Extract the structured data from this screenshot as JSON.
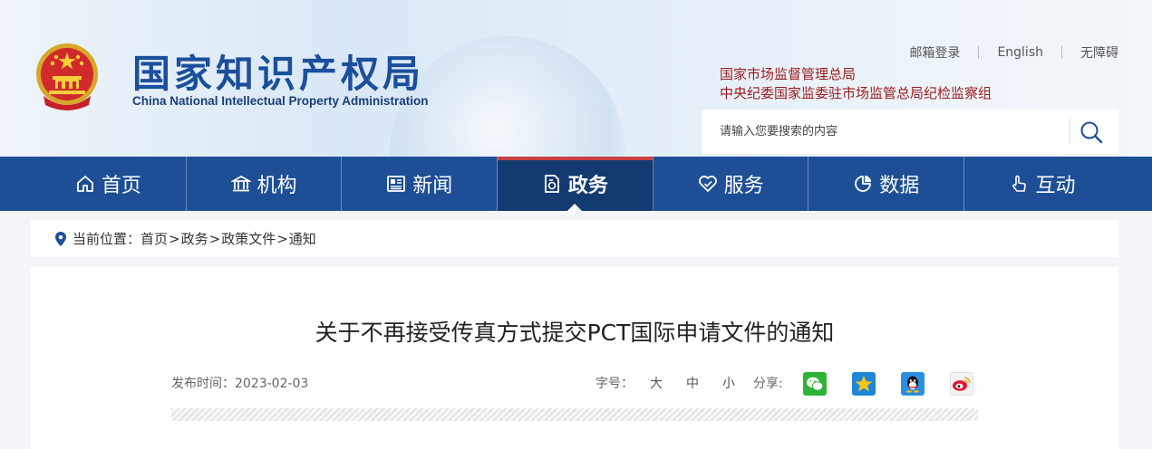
{
  "header": {
    "site_name_cn": "国家知识产权局",
    "site_name_en": "China National Intellectual Property Administration",
    "top_links": [
      "邮箱登录",
      "English",
      "无障碍"
    ],
    "org_line_1": "国家市场监督管理总局",
    "org_line_2": "中央纪委国家监委驻市场监管总局纪检监察组",
    "search_placeholder": "请输入您要搜索的内容"
  },
  "nav": {
    "items": [
      {
        "label": "首页",
        "icon": "home-icon"
      },
      {
        "label": "机构",
        "icon": "institution-icon"
      },
      {
        "label": "新闻",
        "icon": "news-icon"
      },
      {
        "label": "政务",
        "icon": "government-icon",
        "active": true
      },
      {
        "label": "服务",
        "icon": "service-icon"
      },
      {
        "label": "数据",
        "icon": "data-icon"
      },
      {
        "label": "互动",
        "icon": "interaction-icon"
      }
    ]
  },
  "breadcrumb": {
    "prefix": "当前位置：",
    "items": [
      "首页",
      "政务",
      "政策文件",
      "通知"
    ],
    "separator": ">"
  },
  "article": {
    "title": "关于不再接受传真方式提交PCT国际申请文件的通知",
    "publish_label": "发布时间：",
    "publish_date": "2023-02-03",
    "font_size_label": "字号：",
    "font_sizes": [
      "大",
      "中",
      "小"
    ],
    "share_label": "分享:",
    "share_targets": [
      "wechat-icon",
      "qzone-icon",
      "qq-icon",
      "weibo-icon"
    ]
  },
  "colors": {
    "nav_bg": "#1e4f96",
    "nav_active_bg": "#143a72",
    "nav_active_accent": "#c94043",
    "site_name": "#1b4f9c",
    "org_text": "#9a1b1b"
  }
}
